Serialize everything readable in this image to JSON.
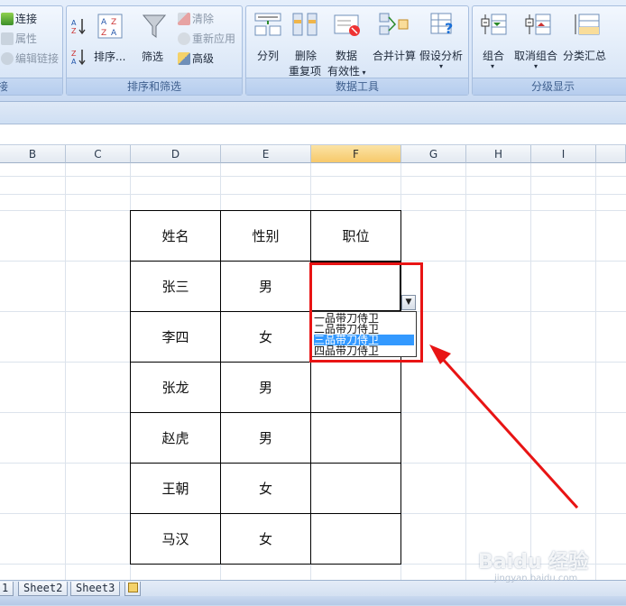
{
  "ribbon": {
    "connections_group": {
      "label": "接",
      "connect": "连接",
      "properties": "属性",
      "edit_links": "编辑链接"
    },
    "sort_filter_group": {
      "label": "排序和筛选",
      "sort": "排序...",
      "filter": "筛选",
      "clear": "清除",
      "reapply": "重新应用",
      "advanced": "高级"
    },
    "data_tools_group": {
      "label": "数据工具",
      "text_to_columns": "分列",
      "remove_duplicates_1": "删除",
      "remove_duplicates_2": "重复项",
      "validation_1": "数据",
      "validation_2": "有效性",
      "consolidate": "合并计算",
      "what_if": "假设分析"
    },
    "outline_group": {
      "label": "分级显示",
      "group": "组合",
      "ungroup": "取消组合",
      "subtotal": "分类汇总"
    }
  },
  "columns": [
    "B",
    "C",
    "D",
    "E",
    "F",
    "G",
    "H",
    "I"
  ],
  "selected_column": "F",
  "table": {
    "headers": [
      "姓名",
      "性别",
      "职位"
    ],
    "rows": [
      [
        "张三",
        "男",
        ""
      ],
      [
        "李四",
        "女",
        ""
      ],
      [
        "张龙",
        "男",
        ""
      ],
      [
        "赵虎",
        "男",
        ""
      ],
      [
        "王朝",
        "女",
        ""
      ],
      [
        "马汉",
        "女",
        ""
      ]
    ]
  },
  "dropdown": {
    "options": [
      "一品带刀侍卫",
      "二品带刀侍卫",
      "三品带刀侍卫",
      "四品带刀侍卫"
    ],
    "highlighted_index": 2
  },
  "sheet_tabs": [
    "1",
    "Sheet2",
    "Sheet3"
  ],
  "watermark": {
    "brand": "Baidu 经验",
    "url": "jingyan.baidu.com"
  },
  "colors": {
    "annotation_red": "#e81414",
    "highlight_blue": "#3399ff",
    "selected_header": "#f7c96a"
  }
}
